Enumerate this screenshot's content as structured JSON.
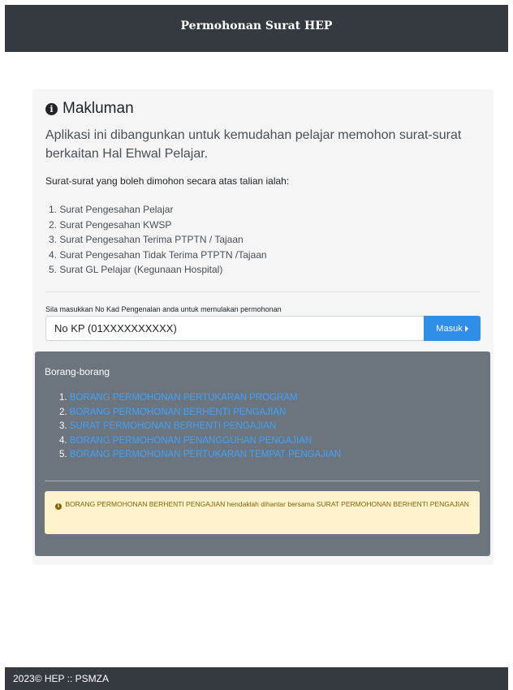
{
  "header": {
    "title": "Permohonan Surat HEP"
  },
  "notice": {
    "title": "Makluman",
    "lead": "Aplikasi ini dibangunkan untuk kemudahan pelajar memohon surat-surat berkaitan Hal Ehwal Pelajar.",
    "subtitle": "Surat-surat yang boleh dimohon secara atas talian ialah:",
    "items": [
      "1. Surat Pengesahan Pelajar",
      "2. Surat Pengesahan KWSP",
      "3. Surat Pengesahan Terima PTPTN / Tajaan",
      "4. Surat Pengesahan Tidak Terima PTPTN /Tajaan",
      "5. Surat GL Pelajar (Kegunaan Hospital)"
    ]
  },
  "login": {
    "label": "Sila masukkan No Kad Pengenalan anda untuk memulakan permohonan",
    "placeholder": "No KP (01XXXXXXXXXX)",
    "button_label": "Masuk"
  },
  "forms": {
    "title": "Borang-borang",
    "items": [
      {
        "num": "1.",
        "label": "BORANG PERMOHONAN PERTUKARAN PROGRAM"
      },
      {
        "num": "2.",
        "label": "BORANG PERMOHONAN BERHENTI PENGAJIAN"
      },
      {
        "num": "3.",
        "label": "SURAT PERMOHONAN BERHENTI PENGAJIAN"
      },
      {
        "num": "4.",
        "label": "BORANG PERMOHONAN PENANGGUHAN PENGAJIAN"
      },
      {
        "num": "5.",
        "label": "BORANG PERMOHONAN PERTUKARAN TEMPAT PENGAJIAN"
      }
    ],
    "warning": "BORANG PERMOHONAN BERHENTI PENGAJIAN hendaklah dihantar bersama SURAT PERMOHONAN BERHENTI PENGAJIAN"
  },
  "footer": {
    "text": "2023© HEP :: PSMZA"
  },
  "colors": {
    "header_bg": "#343a40",
    "card_bg": "#6c757d",
    "link": "#3ea3ff",
    "button": "#2f8ee8",
    "warning_bg": "#fff3cd"
  },
  "icons": {
    "notice": "info-circle-icon",
    "button": "caret-right-icon",
    "warning": "info-circle-icon"
  }
}
